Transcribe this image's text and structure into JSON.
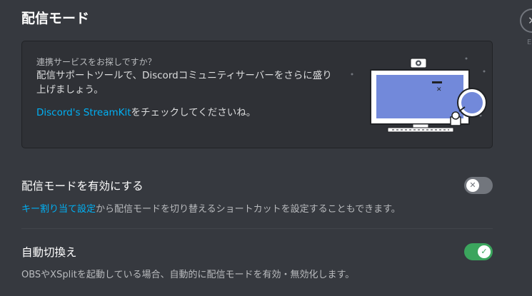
{
  "page": {
    "title": "配信モード"
  },
  "close": {
    "hint": "E"
  },
  "promo": {
    "heading": "連携サービスをお探しですか？",
    "text": "配信サポートツールで、Discordコミュニティサーバーをさらに盛り上げましょう。",
    "link": "Discord's StreamKit",
    "link_suffix": "をチェックしてくださいね。"
  },
  "settings": [
    {
      "title": "配信モードを有効にする",
      "desc_link": "キー割り当て設定",
      "desc": "から配信モードを切り替えるショートカットを設定することもできます。",
      "enabled": false
    },
    {
      "title": "自動切換え",
      "desc": "OBSやXSplitを起動している場合、自動的に配信モードを有効・無効化します。",
      "enabled": true
    }
  ],
  "colors": {
    "background": "#36393f",
    "card": "#2f3136",
    "link": "#00b0f4",
    "toggle_on": "#3ba55d",
    "toggle_off": "#72767d"
  }
}
